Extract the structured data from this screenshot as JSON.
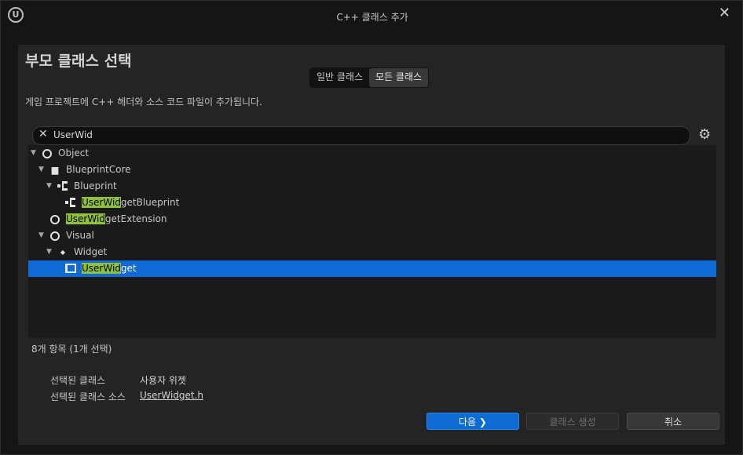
{
  "window": {
    "title": "C++ 클래스 추가",
    "close_glyph": "✕",
    "logo_glyph": "U"
  },
  "heading": "부모 클래스 선택",
  "toggle": {
    "common": "일반 클래스",
    "all": "모든 클래스",
    "active": "all"
  },
  "description": "게임 프로젝트에 C++ 헤더와 소스 코드 파일이 추가됩니다.",
  "search": {
    "value": "UserWid",
    "clear_glyph": "✕",
    "settings_glyph": "⚙"
  },
  "tree": {
    "items": [
      {
        "label": "Object",
        "highlight": "",
        "rest": "Object",
        "depth": 0,
        "expanded": true,
        "icon": "object-icon"
      },
      {
        "label": "BlueprintCore",
        "highlight": "",
        "rest": "BlueprintCore",
        "depth": 1,
        "expanded": true,
        "icon": "book-icon"
      },
      {
        "label": "Blueprint",
        "highlight": "",
        "rest": "Blueprint",
        "depth": 2,
        "expanded": true,
        "icon": "blueprint-icon"
      },
      {
        "label": "UserWidgetBlueprint",
        "highlight": "UserWid",
        "rest": "getBlueprint",
        "depth": 3,
        "expanded": false,
        "icon": "blueprint-icon"
      },
      {
        "label": "UserWidgetExtension",
        "highlight": "UserWid",
        "rest": "getExtension",
        "depth": 1,
        "expanded": false,
        "icon": "object-icon"
      },
      {
        "label": "Visual",
        "highlight": "",
        "rest": "Visual",
        "depth": 1,
        "expanded": true,
        "icon": "object-icon"
      },
      {
        "label": "Widget",
        "highlight": "",
        "rest": "Widget",
        "depth": 2,
        "expanded": true,
        "icon": "diamond-icon"
      },
      {
        "label": "UserWidget",
        "highlight": "UserWid",
        "rest": "get",
        "depth": 3,
        "expanded": false,
        "icon": "widget-icon",
        "selected": true
      }
    ]
  },
  "count_text": "8개 항목 (1개 선택)",
  "selected_info": {
    "class_label": "선택된 클래스",
    "class_value": "사용자 위젯",
    "source_label": "선택된 클래스 소스",
    "source_value": "UserWidget.h"
  },
  "buttons": {
    "next": "다음",
    "next_glyph": "❯",
    "create": "클래스 생성",
    "cancel": "취소"
  },
  "colors": {
    "accent": "#0e6bd3",
    "highlight": "#8fc23a",
    "panel": "#242424"
  }
}
